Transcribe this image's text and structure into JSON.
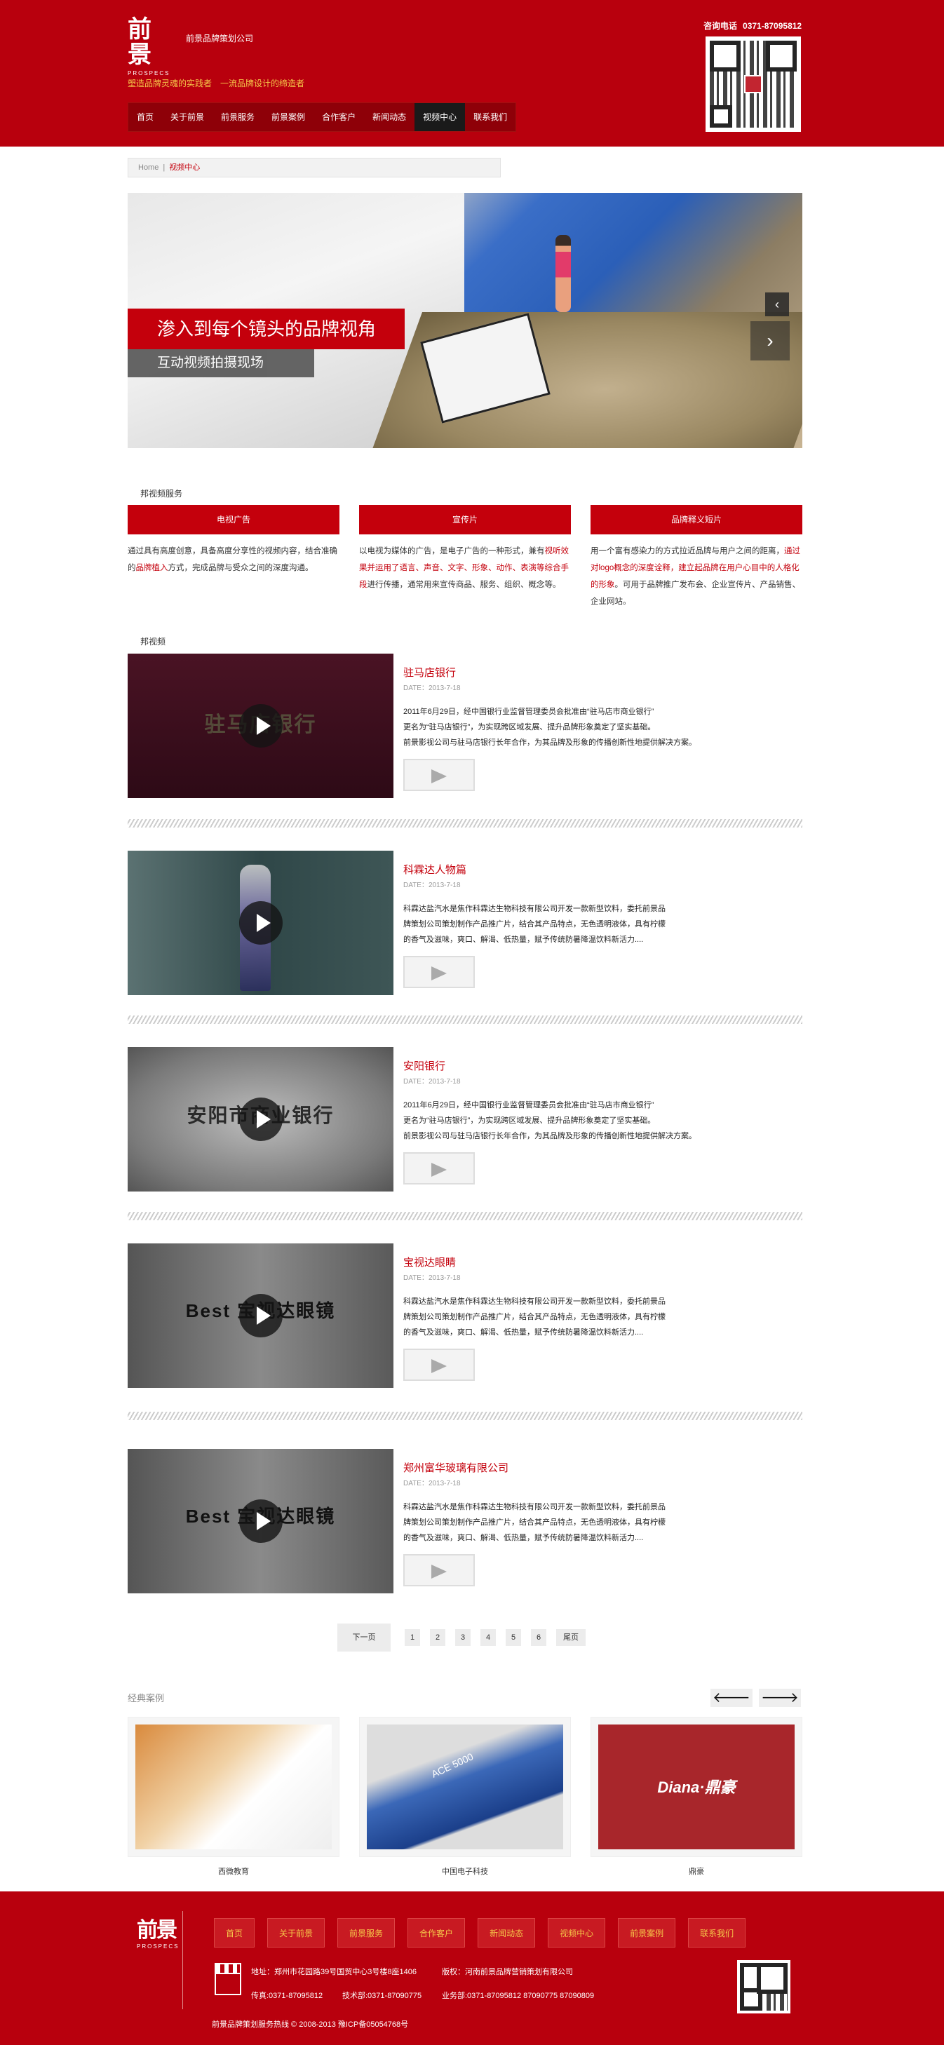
{
  "header": {
    "logo_glyph": "前景",
    "logo_en": "PROSPECS",
    "company": "前景品牌策划公司",
    "slogan": "塑造品牌灵魂的实践者　一流品牌设计的缔造者",
    "hotline_label": "咨询电话",
    "hotline": "0371-87095812",
    "nav": [
      "首页",
      "关于前景",
      "前景服务",
      "前景案例",
      "合作客户",
      "新闻动态",
      "视频中心",
      "联系我们"
    ],
    "nav_active": "视频中心"
  },
  "breadcrumb": {
    "home": "Home",
    "sep": "|",
    "current": "视频中心"
  },
  "banner": {
    "caption_main": "渗入到每个镜头的品牌视角",
    "caption_sub": "互动视频拍摄现场"
  },
  "services": {
    "section_title": "邦视频服务",
    "items": [
      {
        "title": "电视广告",
        "text_a": "通过具有高度创意，具备高度分享性的视频内容，结合准确的",
        "text_red": "品牌植入",
        "text_b": "方式，完成品牌与受众之间的深度沟通。"
      },
      {
        "title": "宣传片",
        "text_a": "以电视为媒体的广告，是电子广告的一种形式，兼有",
        "text_red": "视听效果并运用了语言、声音、文字、形象、动作、表演等综合手段",
        "text_b": "进行传播，通常用来宣传商品、服务、组织、概念等。"
      },
      {
        "title": "品牌释义短片",
        "text_a": "用一个富有感染力的方式拉近品牌与用户之间的距离，",
        "text_red": "通过对logo概念的深度诠释，建立起品牌在用户心目中的人格化的形象",
        "text_b": "。可用于品牌推广发布会、企业宣传片、产品销售、企业网站。"
      }
    ]
  },
  "videos": {
    "section_title": "邦视频",
    "date_label": "DATE：",
    "items": [
      {
        "title": "驻马店银行",
        "date": "2013-7-18",
        "brand": "驻马店银行",
        "desc": [
          "2011年6月29日，经中国银行业监督管理委员会批准由“驻马店市商业银行”",
          "更名为“驻马店银行”，为实现跨区域发展、提升品牌形象奠定了坚实基础。",
          "前景影视公司与驻马店银行长年合作，为其品牌及形象的传播创新性地提供解决方案。"
        ]
      },
      {
        "title": "科霖达人物篇",
        "date": "2013-7-18",
        "brand": "",
        "desc": [
          "科霖达盐汽水是焦作科霖达生物科技有限公司开发一款新型饮料，委托前景品",
          "牌策划公司策划制作产品推广片，结合其产品特点，无色透明液体，具有柠檬",
          "的香气及滋味，爽口、解渴、低热量，赋予传统防暑降温饮料新活力...."
        ]
      },
      {
        "title": "安阳银行",
        "date": "2013-7-18",
        "brand": "安阳市商业银行",
        "desc": [
          "2011年6月29日，经中国银行业监督管理委员会批准由“驻马店市商业银行”",
          "更名为“驻马店银行”，为实现跨区域发展、提升品牌形象奠定了坚实基础。",
          "前景影视公司与驻马店银行长年合作，为其品牌及形象的传播创新性地提供解决方案。"
        ]
      },
      {
        "title": "宝视达眼睛",
        "date": "2013-7-18",
        "brand": "Best 宝视达眼镜",
        "desc": [
          "科霖达盐汽水是焦作科霖达生物科技有限公司开发一款新型饮料，委托前景品",
          "牌策划公司策划制作产品推广片，结合其产品特点，无色透明液体，具有柠檬",
          "的香气及滋味，爽口、解渴、低热量，赋予传统防暑降温饮料新活力...."
        ]
      },
      {
        "title": "郑州富华玻璃有限公司",
        "date": "2013-7-18",
        "brand": "Best 宝视达眼镜",
        "desc": [
          "科霖达盐汽水是焦作科霖达生物科技有限公司开发一款新型饮料，委托前景品",
          "牌策划公司策划制作产品推广片，结合其产品特点，无色透明液体，具有柠檬",
          "的香气及滋味，爽口、解渴、低热量，赋予传统防暑降温饮料新活力...."
        ]
      }
    ]
  },
  "pager": {
    "next": "下一页",
    "pages": [
      "1",
      "2",
      "3",
      "4",
      "5",
      "6"
    ],
    "last": "尾页"
  },
  "cases": {
    "title": "经典案例",
    "prev": "🡐",
    "next": "🡒",
    "items": [
      {
        "caption": "西微教育"
      },
      {
        "caption": "中国电子科技",
        "art": "ACE 5000"
      },
      {
        "caption": "鼎豪",
        "art": "Diana·鼎豪"
      }
    ]
  },
  "footer": {
    "logo_glyph": "前景",
    "logo_en": "PROSPECS",
    "nav": [
      "首页",
      "关于前景",
      "前景服务",
      "合作客户",
      "新闻动态",
      "视频中心",
      "前景案例",
      "联系我们"
    ],
    "address": "地址：郑州市花园路39号国贸中心3号楼8座1406",
    "copyright_owner": "版权：河南前景品牌营销策划有限公司",
    "fax": "传真:0371-87095812",
    "tech": "技术部:0371-87090775",
    "business": "业务部:0371-87095812 87090775 87090809",
    "copyright": "前景品牌策划服务热线 © 2008-2013 豫ICP备05054768号"
  },
  "colors": {
    "brand_red": "#b8000d",
    "accent_red": "#c4000c",
    "nav_active": "#1a1a1a",
    "slogan_gold": "#f6c84a"
  }
}
